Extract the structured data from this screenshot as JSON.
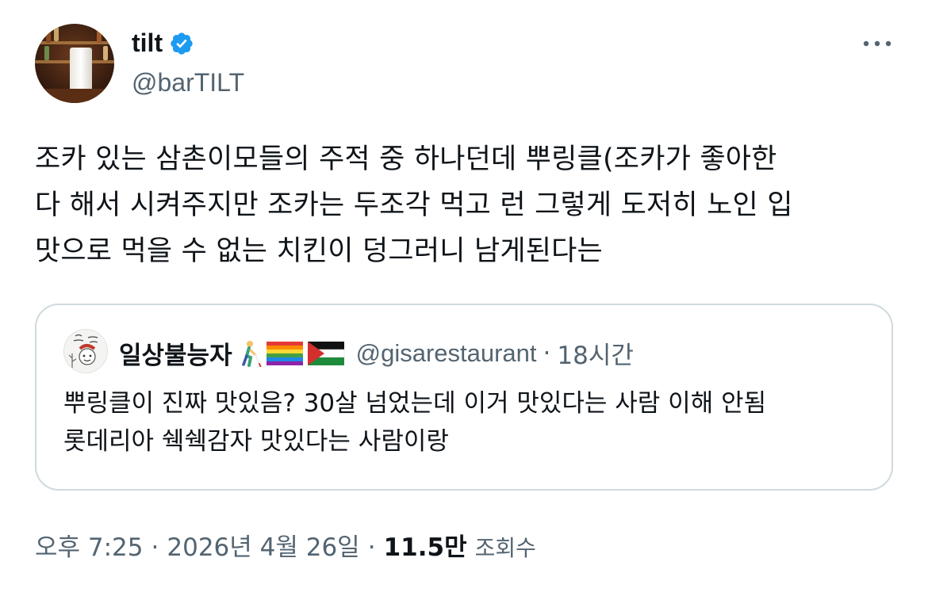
{
  "author": {
    "display_name": "tilt",
    "handle": "@barTILT",
    "verified": true
  },
  "tweet": {
    "lines": [
      "조카 있는 삼촌이모들의 주적 중 하나던데 뿌링클(조카가 좋아한",
      "다 해서 시켜주지만 조카는 두조각 먹고 런 그렇게 도저히 노인 입",
      "맛으로 먹을 수 없는 치킨이 덩그러니 남게된다는"
    ]
  },
  "quote": {
    "display_name": "일상불능자",
    "emoji_icons": [
      "person-with-white-cane-icon",
      "rainbow-flag-icon",
      "palestine-flag-icon"
    ],
    "handle": "@gisarestaurant",
    "separator": "·",
    "time": "18시간",
    "lines": [
      "뿌링클이 진짜 맛있음? 30살 넘었는데 이거 맛있다는 사람 이해 안됨",
      "롯데리아 쉑쉑감자 맛있다는 사람이랑"
    ]
  },
  "meta": {
    "time": "오후 7:25",
    "separator": "·",
    "date": "2026년 4월 26일",
    "views_count": "11.5만",
    "views_label": "조회수"
  },
  "colors": {
    "text": "#0f1419",
    "secondary": "#536471",
    "border": "#cfd9de",
    "verified": "#1d9bf0"
  }
}
